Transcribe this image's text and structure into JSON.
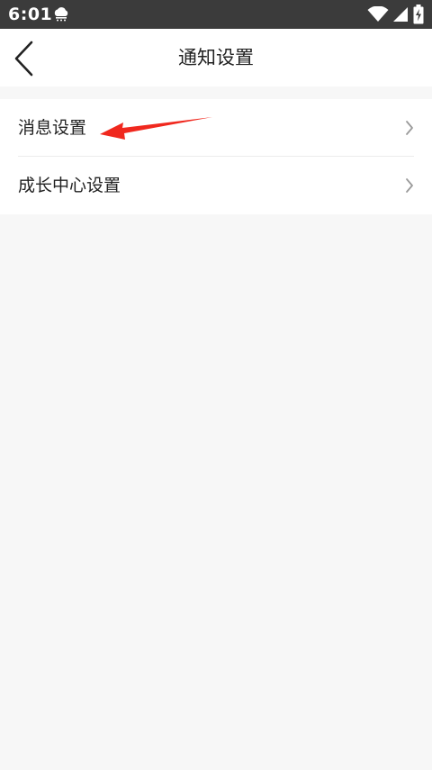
{
  "status_bar": {
    "time": "6:01",
    "icons": [
      "weather-icon",
      "wifi-icon",
      "signal-icon",
      "battery-charging-icon"
    ]
  },
  "nav": {
    "title": "通知设置",
    "back_icon": "chevron-left-icon"
  },
  "settings": {
    "items": [
      {
        "label": "消息设置",
        "icon": "chevron-right-icon"
      },
      {
        "label": "成长中心设置",
        "icon": "chevron-right-icon"
      }
    ]
  },
  "annotation": {
    "arrow_color": "#f0281e"
  },
  "colors": {
    "status_bar_bg": "#3b3b3b",
    "page_bg": "#f7f7f7",
    "card_bg": "#ffffff",
    "text": "#222222",
    "chevron": "#9a9a9a"
  }
}
